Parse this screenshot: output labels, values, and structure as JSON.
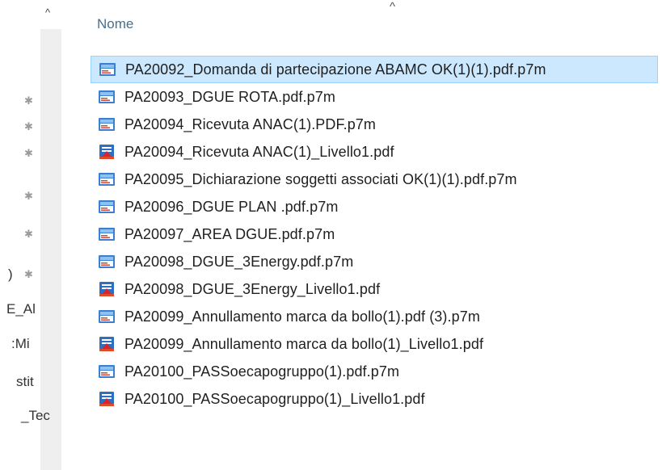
{
  "nav": {
    "up_arrow_glyph": "^",
    "pin_glyph": "📌",
    "truncated_items": [
      ")",
      "E_Al",
      ":Mi",
      "stit",
      "_Tec"
    ]
  },
  "header": {
    "name_label": "Nome",
    "sort_indicator": "^"
  },
  "files": [
    {
      "name": "PA20092_Domanda di partecipazione ABAMC OK(1)(1).pdf.p7m",
      "icon": "p7m-file-icon",
      "selected": true
    },
    {
      "name": "PA20093_DGUE ROTA.pdf.p7m",
      "icon": "p7m-file-icon",
      "selected": false
    },
    {
      "name": "PA20094_Ricevuta ANAC(1).PDF.p7m",
      "icon": "p7m-file-icon",
      "selected": false
    },
    {
      "name": "PA20094_Ricevuta ANAC(1)_Livello1.pdf",
      "icon": "pdf-file-icon",
      "selected": false
    },
    {
      "name": "PA20095_Dichiarazione soggetti associati OK(1)(1).pdf.p7m",
      "icon": "p7m-file-icon",
      "selected": false
    },
    {
      "name": "PA20096_DGUE PLAN .pdf.p7m",
      "icon": "p7m-file-icon",
      "selected": false
    },
    {
      "name": "PA20097_AREA DGUE.pdf.p7m",
      "icon": "p7m-file-icon",
      "selected": false
    },
    {
      "name": "PA20098_DGUE_3Energy.pdf.p7m",
      "icon": "p7m-file-icon",
      "selected": false
    },
    {
      "name": "PA20098_DGUE_3Energy_Livello1.pdf",
      "icon": "pdf-file-icon",
      "selected": false
    },
    {
      "name": "PA20099_Annullamento marca da bollo(1).pdf (3).p7m",
      "icon": "p7m-file-icon",
      "selected": false
    },
    {
      "name": "PA20099_Annullamento marca da bollo(1)_Livello1.pdf",
      "icon": "pdf-file-icon",
      "selected": false
    },
    {
      "name": "PA20100_PASSoecapogruppo(1).pdf.p7m",
      "icon": "p7m-file-icon",
      "selected": false
    },
    {
      "name": "PA20100_PASSoecapogruppo(1)_Livello1.pdf",
      "icon": "pdf-file-icon",
      "selected": false
    }
  ],
  "colors": {
    "selection_bg": "#cce8ff",
    "selection_border": "#99d1ff",
    "header_text": "#4a6f8a"
  }
}
